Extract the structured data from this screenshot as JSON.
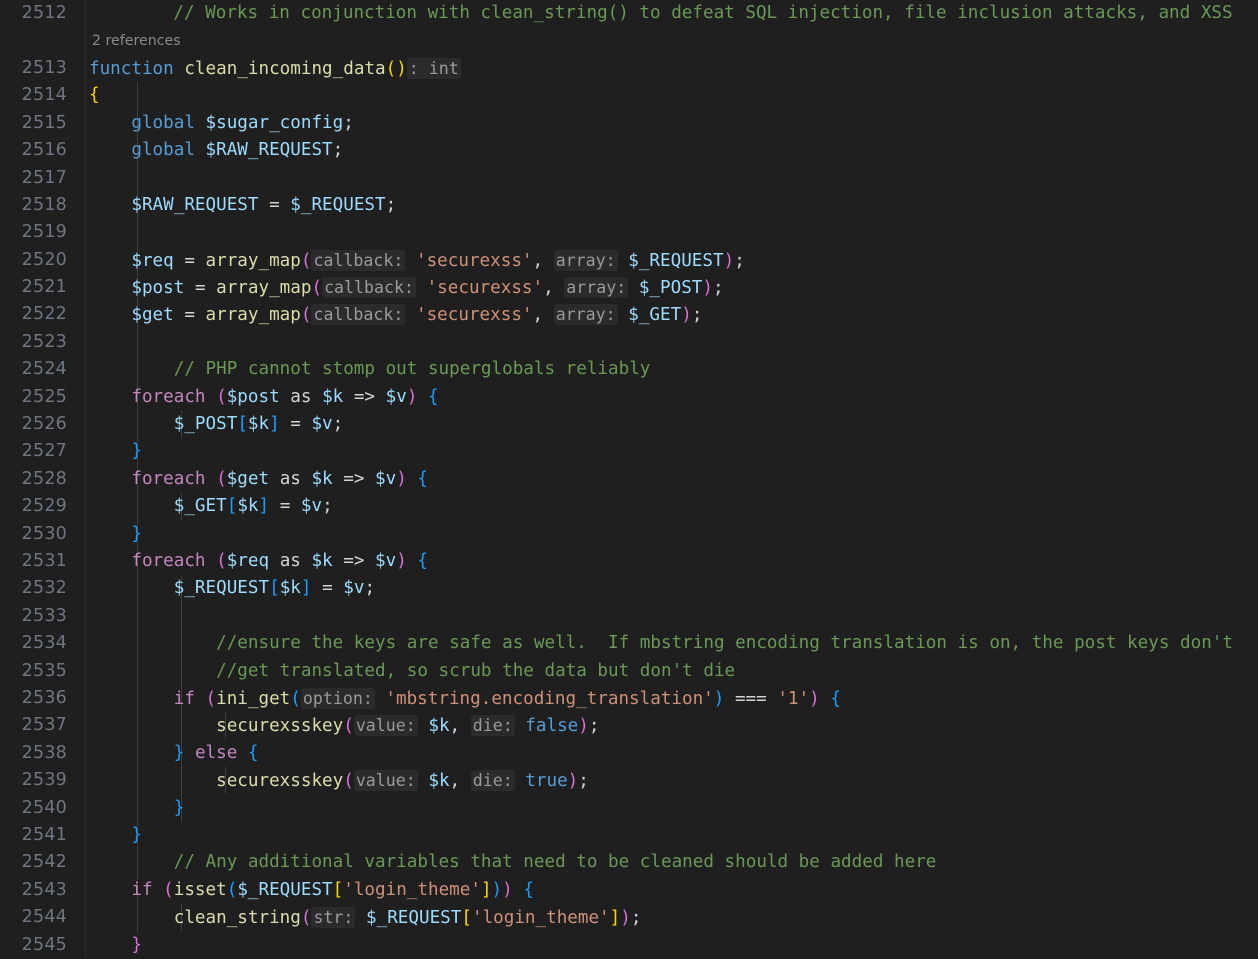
{
  "editor": {
    "language": "php",
    "theme": "dark-modern",
    "background": "#1f1f1f",
    "gutter_color": "#6e7681",
    "first_line": 2512,
    "last_line": 2545,
    "line_height": 27.4,
    "codelens": {
      "label": "2 references",
      "line": 2512
    },
    "colors": {
      "comment": "#6a9955",
      "keyword_control": "#c586c0",
      "keyword": "#569cd6",
      "variable": "#9cdcfe",
      "function": "#dcdcaa",
      "string": "#ce9178",
      "operator": "#d4d4d4",
      "bracket_1": "#ffd700",
      "bracket_2": "#da70d6",
      "bracket_3": "#179fff",
      "inlay_hint_fg": "#9a9a9a",
      "inlay_hint_bg": "#2b2b2b",
      "indent_guide": "#404040"
    },
    "line_numbers": [
      "2512",
      "2513",
      "2514",
      "2515",
      "2516",
      "2517",
      "2518",
      "2519",
      "2520",
      "2521",
      "2522",
      "2523",
      "2524",
      "2525",
      "2526",
      "2527",
      "2528",
      "2529",
      "2530",
      "2531",
      "2532",
      "2533",
      "2534",
      "2535",
      "2536",
      "2537",
      "2538",
      "2539",
      "2540",
      "2541",
      "2542",
      "2543",
      "2544",
      "2545"
    ],
    "lines": [
      {
        "n": "2512",
        "text": "    // Works in conjunction with clean_string() to defeat SQL injection, file inclusion attacks, and XSS"
      },
      {
        "n": "2513",
        "text": "    function clean_incoming_data(): int"
      },
      {
        "n": "2514",
        "text": "    {"
      },
      {
        "n": "2515",
        "text": "        global $sugar_config;"
      },
      {
        "n": "2516",
        "text": "        global $RAW_REQUEST;"
      },
      {
        "n": "2517",
        "text": ""
      },
      {
        "n": "2518",
        "text": "        $RAW_REQUEST = $_REQUEST;"
      },
      {
        "n": "2519",
        "text": ""
      },
      {
        "n": "2520",
        "text": "        $req = array_map(callback: 'securexss', array: $_REQUEST);"
      },
      {
        "n": "2521",
        "text": "        $post = array_map(callback: 'securexss', array: $_POST);"
      },
      {
        "n": "2522",
        "text": "        $get = array_map(callback: 'securexss', array: $_GET);"
      },
      {
        "n": "2523",
        "text": ""
      },
      {
        "n": "2524",
        "text": "        // PHP cannot stomp out superglobals reliably"
      },
      {
        "n": "2525",
        "text": "        foreach ($post as $k => $v) {"
      },
      {
        "n": "2526",
        "text": "            $_POST[$k] = $v;"
      },
      {
        "n": "2527",
        "text": "        }"
      },
      {
        "n": "2528",
        "text": "        foreach ($get as $k => $v) {"
      },
      {
        "n": "2529",
        "text": "            $_GET[$k] = $v;"
      },
      {
        "n": "2530",
        "text": "        }"
      },
      {
        "n": "2531",
        "text": "        foreach ($req as $k => $v) {"
      },
      {
        "n": "2532",
        "text": "            $_REQUEST[$k] = $v;"
      },
      {
        "n": "2533",
        "text": ""
      },
      {
        "n": "2534",
        "text": "            //ensure the keys are safe as well.  If mbstring encoding translation is on, the post keys don't"
      },
      {
        "n": "2535",
        "text": "            //get translated, so scrub the data but don't die"
      },
      {
        "n": "2536",
        "text": "            if (ini_get(option: 'mbstring.encoding_translation') === '1') {"
      },
      {
        "n": "2537",
        "text": "                securexsskey(value: $k, die: false);"
      },
      {
        "n": "2538",
        "text": "            } else {"
      },
      {
        "n": "2539",
        "text": "                securexsskey(value: $k, die: true);"
      },
      {
        "n": "2540",
        "text": "            }"
      },
      {
        "n": "2541",
        "text": "        }"
      },
      {
        "n": "2542",
        "text": "        // Any additional variables that need to be cleaned should be added here"
      },
      {
        "n": "2543",
        "text": "        if (isset($_REQUEST['login_theme'])) {"
      },
      {
        "n": "2544",
        "text": "            clean_string(str: $_REQUEST['login_theme']);"
      },
      {
        "n": "2545",
        "text": "        }"
      }
    ],
    "inlay_hints": [
      {
        "line": "2513",
        "text": ": int"
      },
      {
        "line": "2520",
        "text": "callback:"
      },
      {
        "line": "2520",
        "text": "array:"
      },
      {
        "line": "2521",
        "text": "callback:"
      },
      {
        "line": "2521",
        "text": "array:"
      },
      {
        "line": "2522",
        "text": "callback:"
      },
      {
        "line": "2522",
        "text": "array:"
      },
      {
        "line": "2536",
        "text": "option:"
      },
      {
        "line": "2537",
        "text": "value:"
      },
      {
        "line": "2537",
        "text": "die:"
      },
      {
        "line": "2539",
        "text": "value:"
      },
      {
        "line": "2539",
        "text": "die:"
      },
      {
        "line": "2544",
        "text": "str:"
      }
    ]
  }
}
